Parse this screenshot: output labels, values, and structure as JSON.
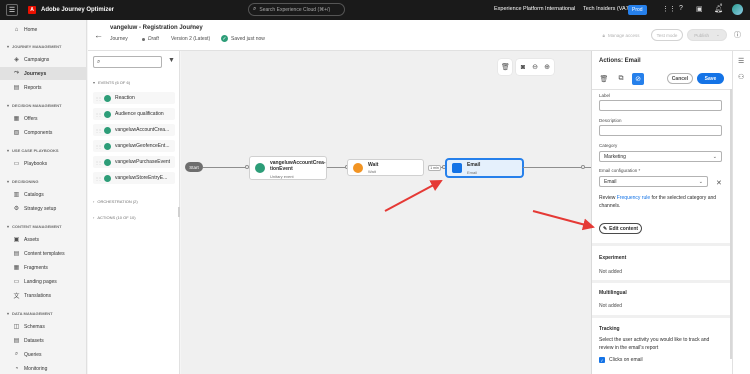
{
  "topbar": {
    "menu_icon": "hamburger-icon",
    "logo_letter": "A",
    "app_name": "Adobe Journey Optimizer",
    "search_placeholder": "Search Experience Cloud (⌘+/)",
    "org": "Experience Platform International",
    "sandbox": "Tech Insiders (VA7)",
    "env_badge": "Prod",
    "notification_count": "9"
  },
  "nav": {
    "home": "Home",
    "sections": [
      {
        "title": "JOURNEY MANAGEMENT",
        "items": [
          "Campaigns",
          "Journeys",
          "Reports"
        ]
      },
      {
        "title": "DECISION MANAGEMENT",
        "items": [
          "Offers",
          "Components"
        ]
      },
      {
        "title": "USE CASE PLAYBOOKS",
        "items": [
          "Playbooks"
        ]
      },
      {
        "title": "DECISIONING",
        "items": [
          "Catalogs",
          "Strategy setup"
        ]
      },
      {
        "title": "CONTENT MANAGEMENT",
        "items": [
          "Assets",
          "Content templates",
          "Fragments",
          "Landing pages",
          "Translations"
        ]
      },
      {
        "title": "DATA MANAGEMENT",
        "items": [
          "Schemas",
          "Datasets",
          "Queries",
          "Monitoring"
        ]
      }
    ]
  },
  "header": {
    "title": "vangeluw - Registration Journey",
    "type": "Journey",
    "status": "Draft",
    "version": "Version 2 (Latest)",
    "saved": "Saved just now",
    "manage_access": "Manage access",
    "test_mode": "Test mode",
    "publish": "Publish"
  },
  "left_panel": {
    "events_header": "EVENTS (6 OF 6)",
    "events": [
      "Reaction",
      "Audience qualification",
      "vangeluwAccountCrea...",
      "vangeluwGeofenceEnt...",
      "vangeluwPurchaseEvent",
      "vangeluwStoreEntryE..."
    ],
    "orchestration_header": "ORCHESTRATION (2)",
    "actions_header": "ACTIONS (10 OF 10)"
  },
  "canvas": {
    "start": "Start",
    "event_node_title": "vangeluwAccountCrea-tionEvent",
    "event_node_sub": "Unitary event",
    "wait_title": "Wait",
    "wait_sub": "Wait",
    "wait_duration": "1 min",
    "email_title": "Email",
    "email_sub": "Email"
  },
  "right_panel": {
    "title": "Actions: Email",
    "cancel": "Cancel",
    "save": "Save",
    "label_label": "Label",
    "description_label": "Description",
    "category_label": "Category",
    "category_value": "Marketing",
    "email_config_label": "Email configuration *",
    "email_config_value": "Email",
    "review_prefix": "Review ",
    "review_link": "Frequency rule",
    "review_suffix": " for the selected category and channels.",
    "edit_content": "Edit content",
    "experiment_title": "Experiment",
    "experiment_value": "Not added",
    "multilingual_title": "Multilingual",
    "multilingual_value": "Not added",
    "tracking_title": "Tracking",
    "tracking_desc": "Select the user activity you would like to track and review in the email's report",
    "clicks_on_email": "Clicks on email"
  },
  "colors": {
    "accent": "#1473e6",
    "event_green": "#2d9d78",
    "arrow_red": "#e53935",
    "wait_orange": "#f29423"
  }
}
